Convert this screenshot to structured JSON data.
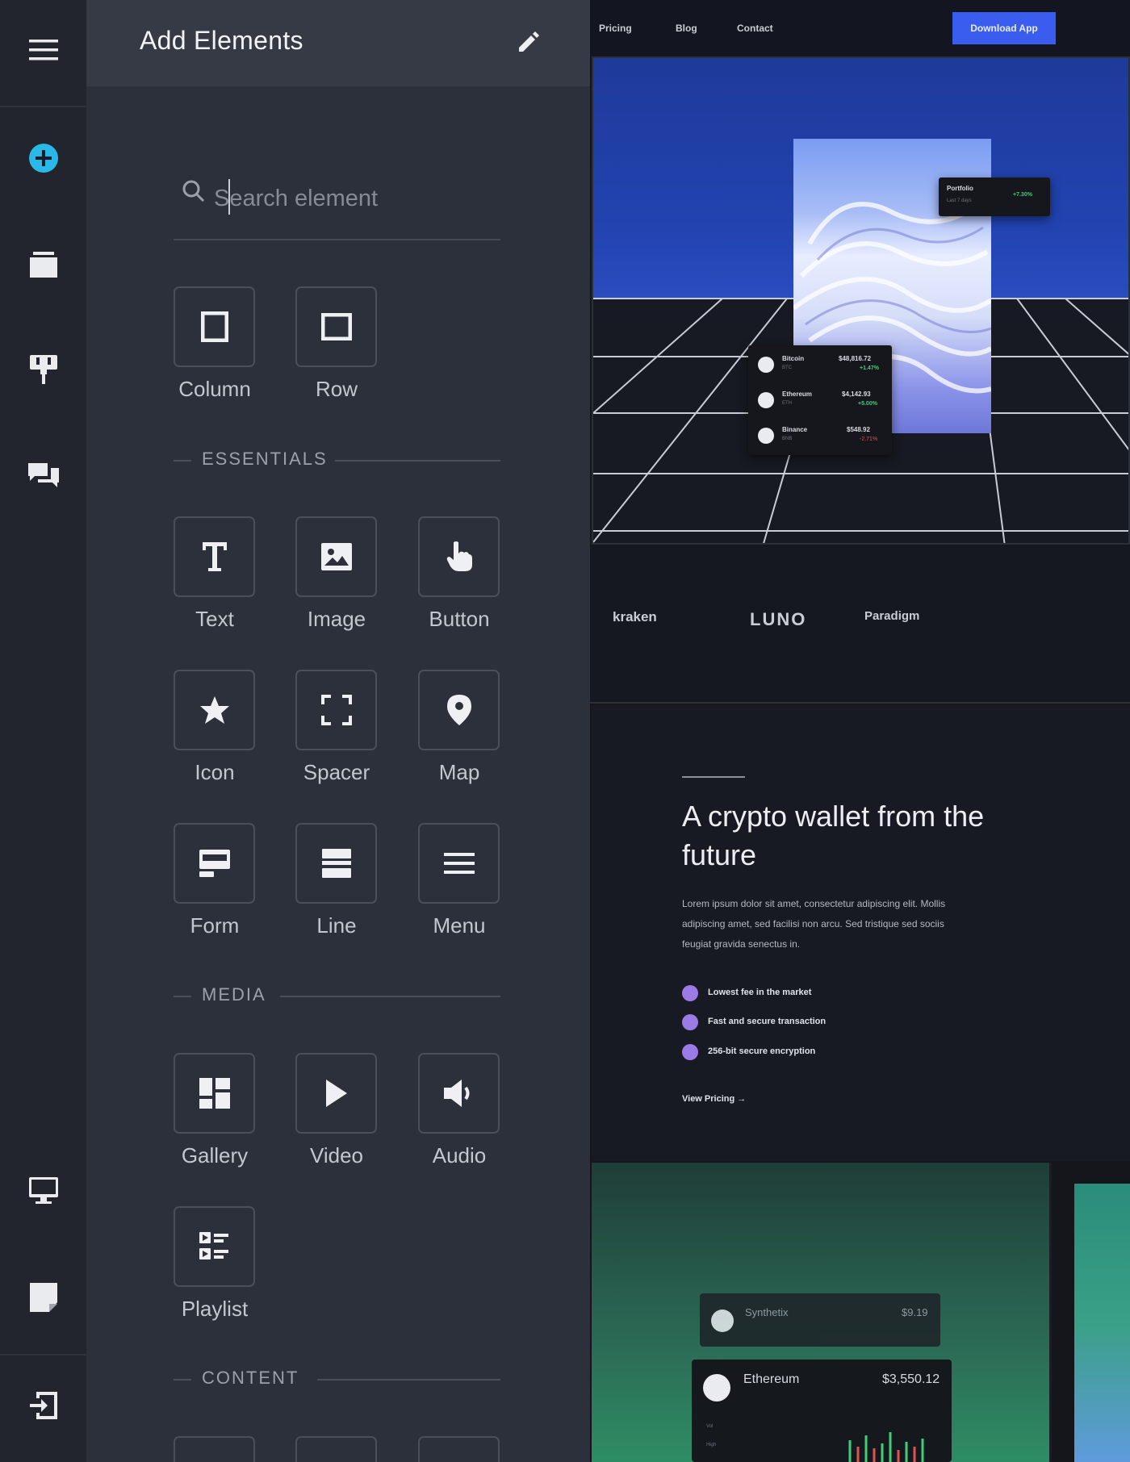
{
  "rail": {
    "items": [
      {
        "id": "menu",
        "icon": "hamburger-menu-icon"
      },
      {
        "id": "add",
        "icon": "add-circle-icon",
        "accent": "#2ab8e6"
      },
      {
        "id": "pages",
        "icon": "pages-icon"
      },
      {
        "id": "paint",
        "icon": "paint-roller-icon"
      },
      {
        "id": "comments",
        "icon": "comments-icon"
      },
      {
        "id": "desktop",
        "icon": "desktop-preview-icon"
      },
      {
        "id": "notes",
        "icon": "sticky-note-icon"
      },
      {
        "id": "exit",
        "icon": "exit-icon"
      }
    ]
  },
  "panel": {
    "title": "Add Elements",
    "search": {
      "placeholder": "Search element",
      "value": ""
    },
    "layout": [
      {
        "label": "Column",
        "icon": "column-icon"
      },
      {
        "label": "Row",
        "icon": "row-icon"
      }
    ],
    "essentials_label": "ESSENTIALS",
    "essentials": [
      {
        "label": "Text",
        "icon": "text-icon"
      },
      {
        "label": "Image",
        "icon": "image-icon"
      },
      {
        "label": "Button",
        "icon": "hand-pointer-icon"
      },
      {
        "label": "Icon",
        "icon": "star-icon"
      },
      {
        "label": "Spacer",
        "icon": "spacer-icon"
      },
      {
        "label": "Map",
        "icon": "map-pin-icon"
      },
      {
        "label": "Form",
        "icon": "form-icon"
      },
      {
        "label": "Line",
        "icon": "line-icon"
      },
      {
        "label": "Menu",
        "icon": "menu-icon"
      }
    ],
    "media_label": "MEDIA",
    "media": [
      {
        "label": "Gallery",
        "icon": "gallery-icon"
      },
      {
        "label": "Video",
        "icon": "play-icon"
      },
      {
        "label": "Audio",
        "icon": "speaker-icon"
      },
      {
        "label": "Playlist",
        "icon": "playlist-icon"
      }
    ],
    "content_label": "CONTENT"
  },
  "preview": {
    "nav": {
      "links": [
        "Pricing",
        "Blog",
        "Contact"
      ],
      "cta": "Download App"
    },
    "portfolio": {
      "title": "Portfolio",
      "sub": "Last 7 days",
      "change": "+7.30%"
    },
    "coins": [
      {
        "name": "Bitcoin",
        "ticker": "BTC",
        "price": "$48,816.72",
        "change": "+1.47%",
        "dir": "up"
      },
      {
        "name": "Ethereum",
        "ticker": "ETH",
        "price": "$4,142.93",
        "change": "+5.00%",
        "dir": "up"
      },
      {
        "name": "Binance",
        "ticker": "BNB",
        "price": "$548.92",
        "change": "-2.71%",
        "dir": "down"
      }
    ],
    "logos": [
      "kraken",
      "LUNO",
      "Paradigm"
    ],
    "feature": {
      "title": "A crypto wallet from the future",
      "body": "Lorem ipsum dolor sit amet, consectetur adipiscing elit. Mollis adipiscing amet, sed facilisi non arcu. Sed tristique sed sociis feugiat gravida senectus in.",
      "bullets": [
        "Lowest fee in the market",
        "Fast and secure transaction",
        "256-bit secure encryption"
      ],
      "link": "View Pricing →"
    },
    "tickers": [
      {
        "name": "Synthetix",
        "price": "$9.19"
      },
      {
        "name": "Ethereum",
        "price": "$3,550.12",
        "vol": "Vol",
        "high": "High"
      }
    ],
    "accent": "#3a5df0",
    "check_color": "#9b7be6"
  }
}
